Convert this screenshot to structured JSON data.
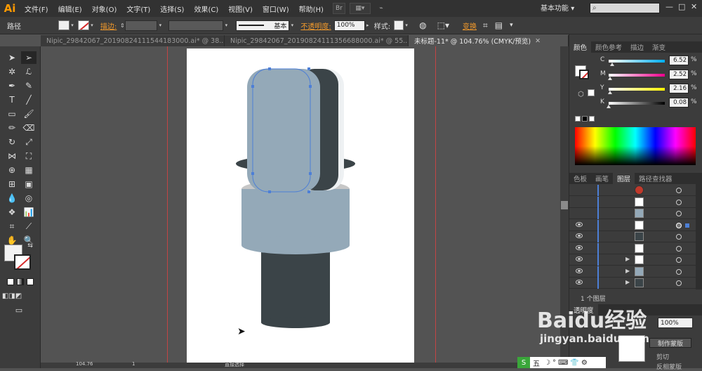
{
  "app": {
    "logo": "Ai"
  },
  "menu": [
    "文件(F)",
    "编辑(E)",
    "对象(O)",
    "文字(T)",
    "选择(S)",
    "效果(C)",
    "视图(V)",
    "窗口(W)",
    "帮助(H)"
  ],
  "menubar_extra": {
    "bridge": "Br",
    "workspace": "基本功能",
    "workspace_arrow": "▾"
  },
  "window_controls": {
    "minimize": "—",
    "maximize": "□",
    "close": "✕"
  },
  "control": {
    "selection_label": "路径",
    "stroke_label": "描边:",
    "brush_label": "基本",
    "opacity_label": "不透明度:",
    "opacity_value": "100%",
    "style_label": "样式:",
    "transform_label": "变换"
  },
  "tabs": [
    {
      "label": "Nipic_29842067_20190824111544183000.ai* @ 38...",
      "active": false
    },
    {
      "label": "Nipic_29842067_20190824111356688000.ai* @ 55...",
      "active": false
    },
    {
      "label": "未标题-11* @ 104.76% (CMYK/预览)",
      "active": true
    }
  ],
  "panels": {
    "color_tabs": [
      "颜色",
      "颜色参考",
      "描边",
      "渐变"
    ],
    "cmyk": [
      {
        "label": "C",
        "value": "6.52",
        "pct": "%",
        "knob": 0.065,
        "track": "linear-gradient(to right,#fff,#00aeef)"
      },
      {
        "label": "M",
        "value": "2.52",
        "pct": "%",
        "knob": 0.025,
        "track": "linear-gradient(to right,#fff,#ec008c)"
      },
      {
        "label": "Y",
        "value": "2.16",
        "pct": "%",
        "knob": 0.022,
        "track": "linear-gradient(to right,#fff,#fff200)"
      },
      {
        "label": "K",
        "value": "0.08",
        "pct": "%",
        "knob": 0.001,
        "track": "linear-gradient(to right,#fff,#000)"
      }
    ],
    "layers_tabs": [
      "色板",
      "画笔",
      "图层",
      "路径查找器"
    ],
    "layers_footer": "1 个图层",
    "transparency_tab": "透明度",
    "transparency_value": "100%",
    "make_mask": "制作蒙版",
    "clip": "剪切",
    "invert_mask": "反相蒙版",
    "layer_rows": [
      {
        "eye": false,
        "thumb": "#c0392b",
        "expand": false
      },
      {
        "eye": false,
        "thumb": "#ffffff",
        "expand": false
      },
      {
        "eye": false,
        "thumb": "#94a9b8",
        "expand": false
      },
      {
        "eye": true,
        "thumb": "#ffffff",
        "expand": false,
        "selected": true
      },
      {
        "eye": true,
        "thumb": "#3b4448",
        "expand": false
      },
      {
        "eye": true,
        "thumb": "#ffffff",
        "expand": false
      },
      {
        "eye": true,
        "thumb": "#ffffff",
        "expand": true
      },
      {
        "eye": true,
        "thumb": "#94a9b8",
        "expand": true
      },
      {
        "eye": true,
        "thumb": "#3b4448",
        "expand": true
      }
    ]
  },
  "status": {
    "zoom": "104.76",
    "page": "1",
    "tool": "直接选择"
  },
  "watermark": {
    "line1": "Baidu经验",
    "line2": "jingyan.baidu.com"
  },
  "ime": {
    "label": "五"
  },
  "colors": {
    "accent_orange": "#f39a2b",
    "layer_blue": "#4d7fd6",
    "mic_blue": "#94a9b8",
    "mic_dark": "#3b4448",
    "mic_rim": "#c7c7c7"
  }
}
